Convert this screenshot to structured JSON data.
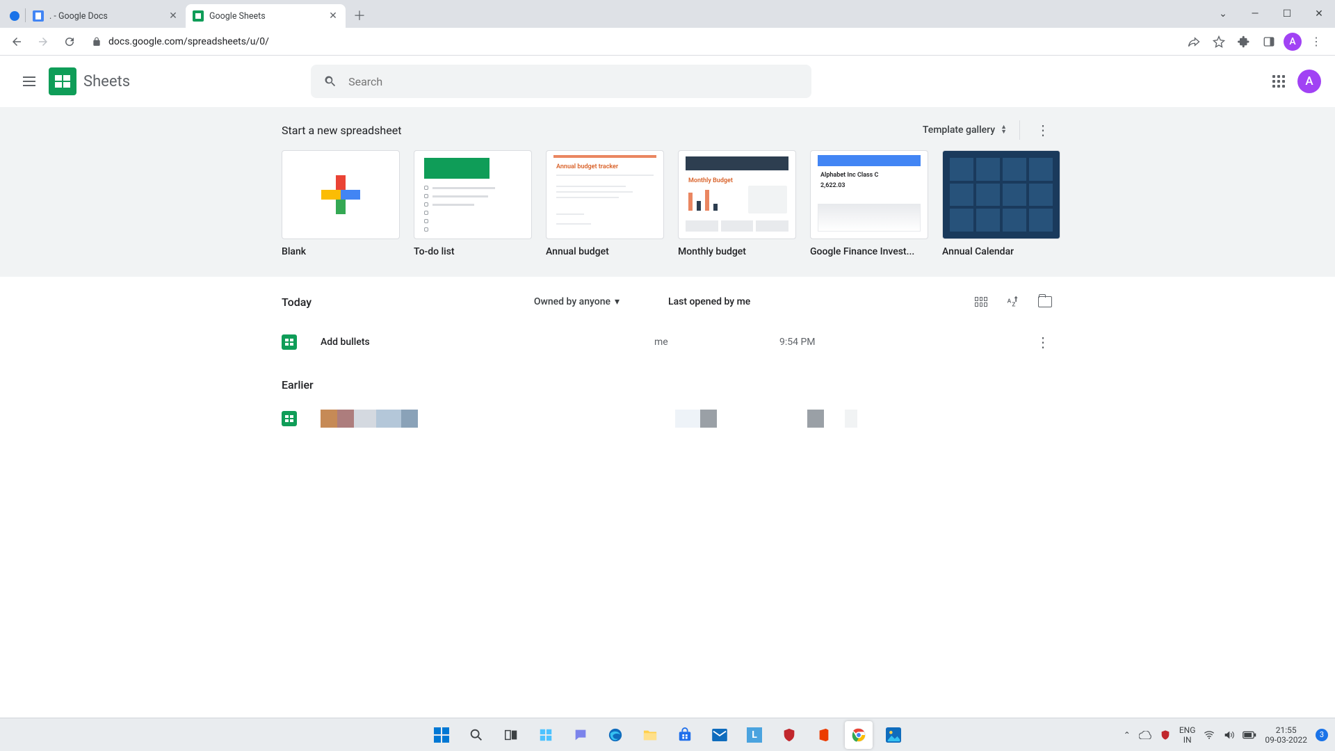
{
  "browser": {
    "tabs": [
      {
        "title": ". - Google Docs",
        "active": false
      },
      {
        "title": "Google Sheets",
        "active": true
      }
    ],
    "url": "docs.google.com/spreadsheets/u/0/",
    "profile_letter": "A"
  },
  "app": {
    "name": "Sheets",
    "search_placeholder": "Search",
    "avatar_letter": "A"
  },
  "templates": {
    "heading": "Start a new spreadsheet",
    "gallery_label": "Template gallery",
    "items": [
      {
        "label": "Blank"
      },
      {
        "label": "To-do list"
      },
      {
        "label": "Annual budget"
      },
      {
        "label": "Monthly budget"
      },
      {
        "label": "Google Finance Invest..."
      },
      {
        "label": "Annual Calendar"
      }
    ],
    "thumb_text": {
      "annual_budget_title": "Annual budget tracker",
      "monthly_budget_title": "Monthly Budget",
      "finance_title": "Alphabet Inc Class C",
      "finance_value": "2,622.03"
    }
  },
  "docs": {
    "section_today": "Today",
    "section_earlier": "Earlier",
    "owner_filter": "Owned by anyone",
    "sort_label": "Last opened by me",
    "rows": [
      {
        "name": "Add bullets",
        "owner": "me",
        "time": "9:54 PM"
      }
    ]
  },
  "taskbar": {
    "lang_top": "ENG",
    "lang_bottom": "IN",
    "time": "21:55",
    "date": "09-03-2022",
    "notif_count": "3"
  }
}
